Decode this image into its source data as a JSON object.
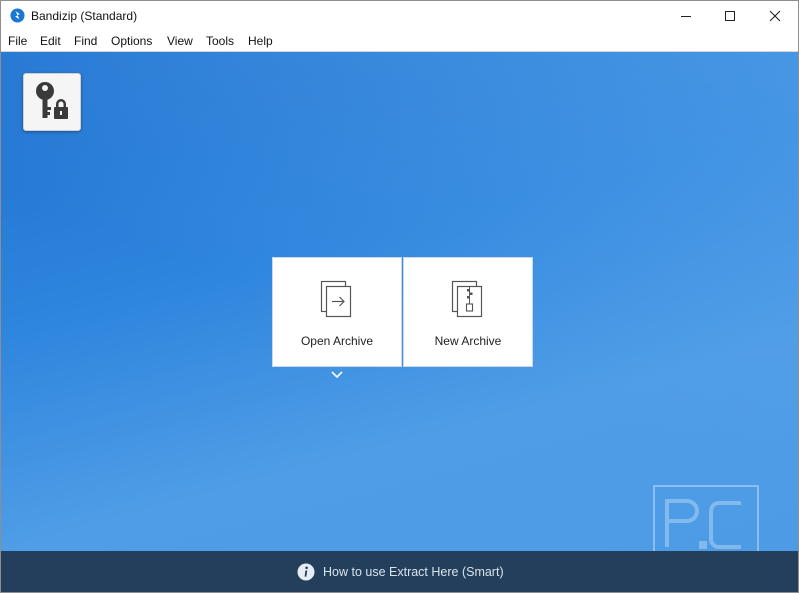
{
  "window": {
    "title": "Bandizip (Standard)",
    "controls": {
      "minimize": "minimize-icon",
      "maximize": "maximize-icon",
      "close": "close-icon"
    }
  },
  "menu": {
    "items": [
      {
        "label": "File"
      },
      {
        "label": "Edit"
      },
      {
        "label": "Find"
      },
      {
        "label": "Options"
      },
      {
        "label": "View"
      },
      {
        "label": "Tools"
      },
      {
        "label": "Help"
      }
    ]
  },
  "main": {
    "password_badge_icon": "key-lock-icon",
    "tiles": [
      {
        "label": "Open Archive",
        "icon": "open-archive-icon"
      },
      {
        "label": "New Archive",
        "icon": "new-archive-icon"
      }
    ],
    "open_dropdown_icon": "chevron-down-icon"
  },
  "footer": {
    "info_icon": "info-icon",
    "text": "How to use Extract Here (Smart)"
  },
  "colors": {
    "content_bg": "#2f86de",
    "footer_bg": "#243f5c",
    "app_icon": "#1a78d2"
  }
}
